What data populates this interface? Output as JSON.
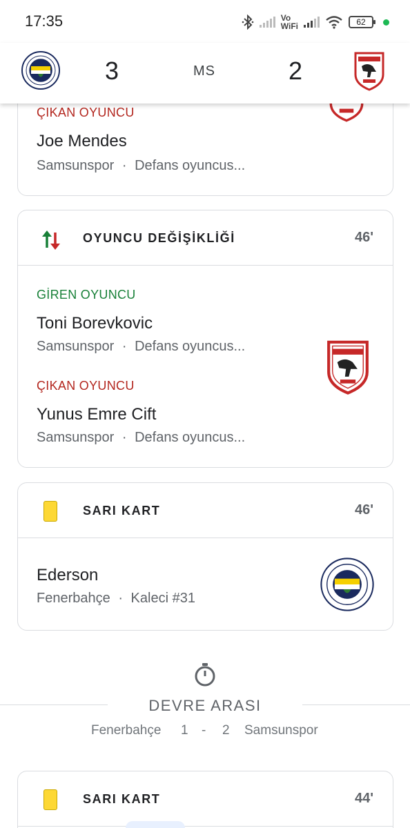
{
  "status_bar": {
    "time": "17:35",
    "network_label_top": "Vo",
    "network_label_bottom": "WiFi",
    "battery": "62",
    "icons": [
      "bluetooth-icon",
      "signal-icon",
      "wifi-icon",
      "battery-icon"
    ],
    "dot_color": "#1db954"
  },
  "header": {
    "home_score": "3",
    "away_score": "2",
    "status": "MS",
    "home_team": "Fenerbahçe",
    "away_team": "Samsunspor"
  },
  "events": [
    {
      "type": "substitution_partial",
      "out_label": "ÇIKAN OYUNCU",
      "out_player": "Joe Mendes",
      "out_team": "Samsunspor",
      "out_position": "Defans oyuncus..."
    },
    {
      "type": "substitution",
      "title": "OYUNCU DEĞİŞİKLİĞİ",
      "minute": "46'",
      "in_label": "GİREN OYUNCU",
      "in_player": "Toni Borevkovic",
      "in_team": "Samsunspor",
      "in_position": "Defans oyuncus...",
      "out_label": "ÇIKAN OYUNCU",
      "out_player": "Yunus Emre Cift",
      "out_team": "Samsunspor",
      "out_position": "Defans oyuncus..."
    },
    {
      "type": "yellow_card",
      "title": "SARI KART",
      "minute": "46'",
      "player": "Ederson",
      "team": "Fenerbahçe",
      "detail": "Kaleci #31"
    },
    {
      "type": "yellow_card",
      "title": "SARI KART",
      "minute": "44'"
    }
  ],
  "half_time": {
    "title": "DEVRE ARASI",
    "home_team": "Fenerbahçe",
    "home_score": "1",
    "separator": "-",
    "away_score": "2",
    "away_team": "Samsunspor"
  },
  "separator_dot": "·",
  "colors": {
    "in_green": "#188038",
    "out_red": "#b3261e",
    "yellow_card": "#fdd835",
    "samsunspor_red": "#c62828",
    "fener_navy": "#1a2a5e",
    "fener_yellow": "#f5d000"
  }
}
